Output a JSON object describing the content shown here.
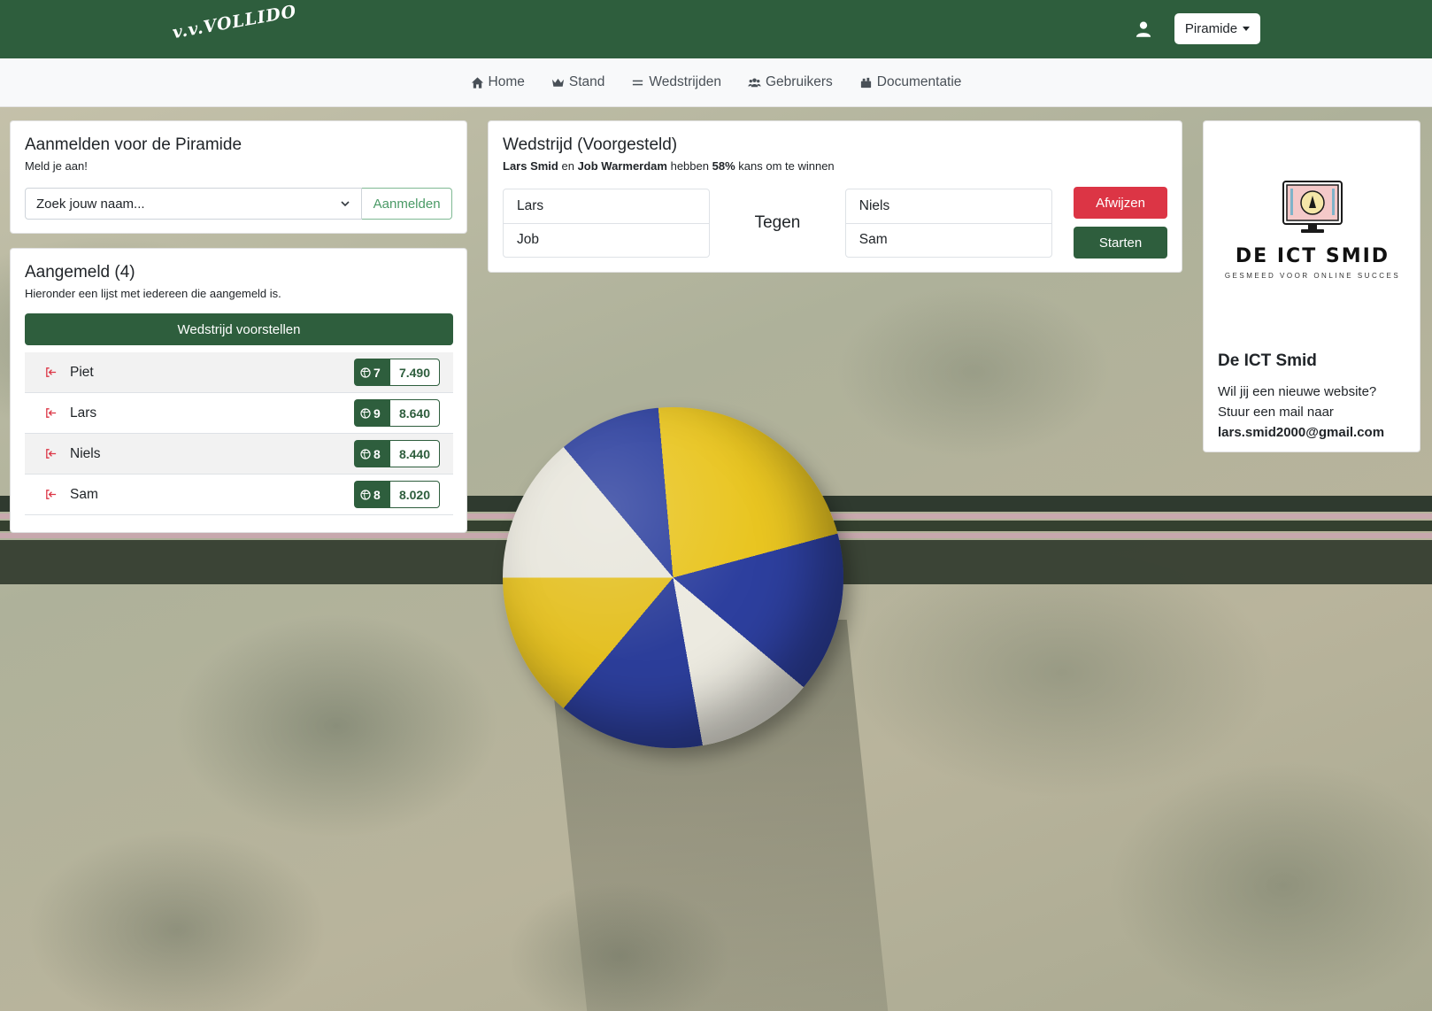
{
  "app": {
    "logo_text": "v.v.VOLLIDO",
    "dropdown_label": "Piramide"
  },
  "nav": {
    "items": [
      {
        "label": "Home",
        "icon": "home-icon"
      },
      {
        "label": "Stand",
        "icon": "crown-icon"
      },
      {
        "label": "Wedstrijden",
        "icon": "equals-icon"
      },
      {
        "label": "Gebruikers",
        "icon": "users-icon"
      },
      {
        "label": "Documentatie",
        "icon": "docs-icon"
      }
    ]
  },
  "signup": {
    "title": "Aanmelden voor de Piramide",
    "subtitle": "Meld je aan!",
    "select_placeholder": "Zoek jouw naam...",
    "button_label": "Aanmelden"
  },
  "registered": {
    "title": "Aangemeld (4)",
    "subtitle": "Hieronder een lijst met iedereen die aangemeld is.",
    "propose_button": "Wedstrijd voorstellen",
    "players": [
      {
        "name": "Piet",
        "rank": "7",
        "score": "7.490"
      },
      {
        "name": "Lars",
        "rank": "9",
        "score": "8.640"
      },
      {
        "name": "Niels",
        "rank": "8",
        "score": "8.440"
      },
      {
        "name": "Sam",
        "rank": "8",
        "score": "8.020"
      }
    ]
  },
  "match": {
    "title": "Wedstrijd (Voorgesteld)",
    "player_a": "Lars Smid",
    "conj": "en",
    "player_b": "Job Warmerdam",
    "middle": "hebben",
    "percent": "58%",
    "suffix": "kans om te winnen",
    "team1": [
      "Lars",
      "Job"
    ],
    "vs_label": "Tegen",
    "team2": [
      "Niels",
      "Sam"
    ],
    "reject_label": "Afwijzen",
    "start_label": "Starten"
  },
  "sponsor": {
    "brand": "DE ICT SMID",
    "tagline": "GESMEED VOOR ONLINE SUCCES",
    "title": "De ICT Smid",
    "line1": "Wil jij een nieuwe website?",
    "line2": "Stuur een mail naar",
    "email": "lars.smid2000@gmail.com"
  },
  "colors": {
    "primary": "#2e5e3d",
    "danger": "#dc3545",
    "navbar_bg": "#f8f9fa"
  }
}
